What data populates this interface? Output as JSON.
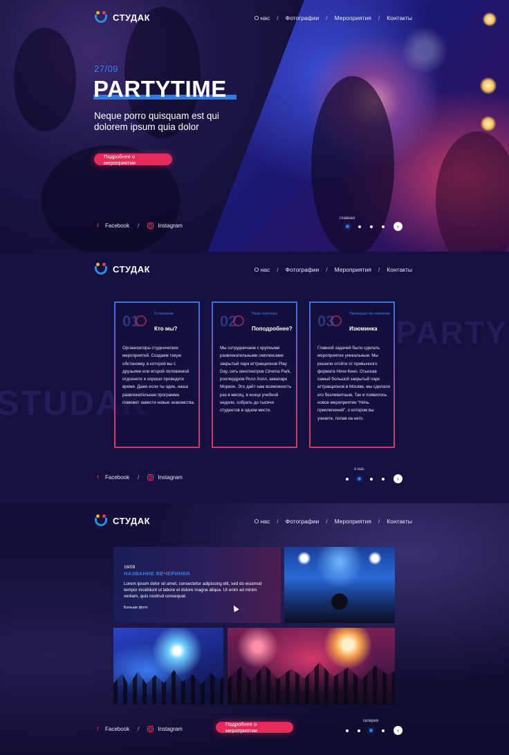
{
  "logo": {
    "text": "СТУДАК"
  },
  "nav": [
    "О нас",
    "Фотографии",
    "Мероприятия",
    "Контакты"
  ],
  "nav_separator": "/",
  "social": {
    "facebook": "Facebook",
    "instagram": "Instagram"
  },
  "hero": {
    "date": "27/09",
    "title": "PARTYTIME",
    "subtitle": "Neque porro quisquam est qui dolorem ipsum quia dolor",
    "button": "Подробнее о мероприятии",
    "slider_label": "главная",
    "slider_active_index": 0
  },
  "about": {
    "watermark_left": "STUDAK",
    "watermark_right": "PARTY",
    "slider_label": "о нас",
    "slider_active_index": 1,
    "cards": [
      {
        "num": "01",
        "kicker": "О компании",
        "head": "Кто мы?",
        "body": "Организаторы студенческих мероприятий. Создаем такую обстановку, в которой вы с друзьями или второй половинкой отдохнете и хорошо проведете время. Даже если ты один, наша развлекательная программа поможет завести новые знакомства."
      },
      {
        "num": "02",
        "kicker": "Наши партнеры",
        "head": "Поподробнее?",
        "body": "Мы сотрудничаем с крупными развлекательными омплексами: закрытый парк аттракционов Play Day, сеть кинотеатров Cinema Park, роллердром Ролл Холл, аквапарк Мореон. Это даёт нам возможность раз в месяц, в конце учебной недели, собрать до тысячи студентов в одном месте."
      },
      {
        "num": "03",
        "kicker": "Преимущества компании",
        "head": "Изюминка",
        "body": "Главной задачей было сделать мероприятие уникальным. Мы решили отойти от привычного формата Ночи Кино. Отыскав самый большой закрытый парк аттракционов в Москве, мы сделали его безлимитным. Так и появилось новое мероприятие “Ночь приключений”, о котором вы узнаете, попав на него."
      }
    ]
  },
  "gallery": {
    "date": "18/09",
    "title": "НАЗВАНИЕ ВЕЧЕРИНКИ",
    "text": "Lorem ipsum dolor sit amet, consectetur adipiscing elit, sed do eiusmod tempor incididunt ut labore et dolore magna aliqua. Ut enim ad minim veniam, quis nostrud consequat.",
    "more": "Больше фото",
    "button": "Подробнее о мероприятии",
    "slider_label": "галерея",
    "slider_active_index": 2
  },
  "colors": {
    "accent_blue": "#2f7be8",
    "accent_pink": "#e52a5b",
    "background": "#120e35"
  }
}
